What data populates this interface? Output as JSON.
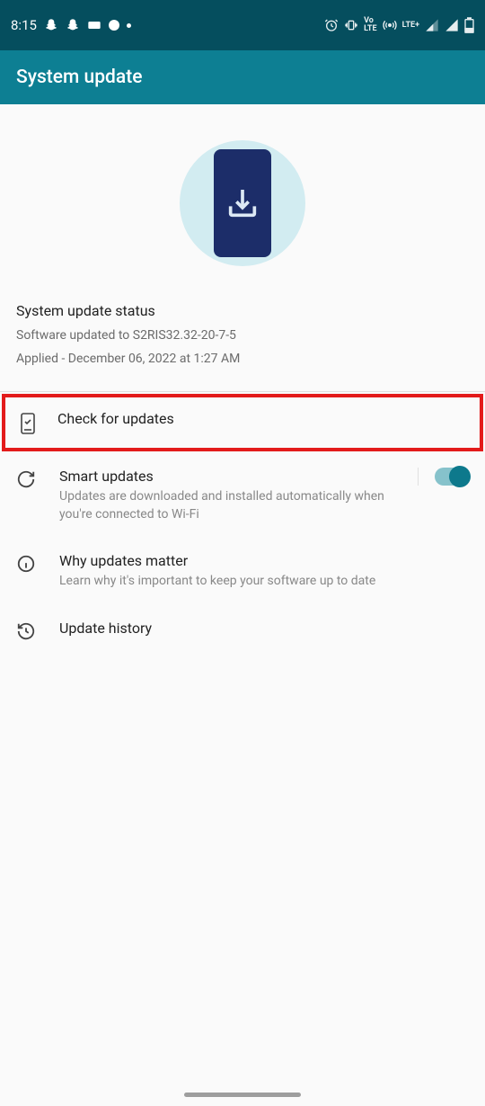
{
  "status_bar": {
    "time": "8:15",
    "network": "LTE+"
  },
  "app_bar": {
    "title": "System update"
  },
  "update_status": {
    "heading": "System update status",
    "software_line": "Software updated to S2RIS32.32-20-7-5",
    "applied_line": "Applied - December 06, 2022 at 1:27 AM"
  },
  "items": {
    "check": {
      "title": "Check for updates"
    },
    "smart": {
      "title": "Smart updates",
      "sub": "Updates are downloaded and installed automatically when you're connected to Wi-Fi"
    },
    "why": {
      "title": "Why updates matter",
      "sub": "Learn why it's important to keep your software up to date"
    },
    "history": {
      "title": "Update history"
    }
  }
}
